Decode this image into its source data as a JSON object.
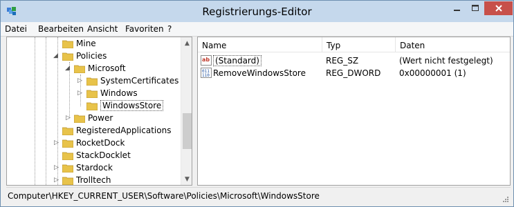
{
  "window": {
    "title": "Registrierungs-Editor",
    "app_icon": "regedit-icon",
    "controls": {
      "minimize": "minimize-icon",
      "maximize": "maximize-icon",
      "close": "close-icon"
    }
  },
  "menubar": {
    "items": [
      {
        "label": "Datei"
      },
      {
        "label": "Bearbeiten"
      },
      {
        "label": "Ansicht"
      },
      {
        "label": "Favoriten"
      },
      {
        "label": "?"
      }
    ]
  },
  "tree": {
    "items": [
      {
        "label": "Mine"
      },
      {
        "label": "Policies"
      },
      {
        "label": "Microsoft"
      },
      {
        "label": "SystemCertificates"
      },
      {
        "label": "Windows"
      },
      {
        "label": "WindowsStore"
      },
      {
        "label": "Power"
      },
      {
        "label": "RegisteredApplications"
      },
      {
        "label": "RocketDock"
      },
      {
        "label": "StackDocklet"
      },
      {
        "label": "Stardock"
      },
      {
        "label": "Trolltech"
      }
    ]
  },
  "list": {
    "columns": {
      "name": "Name",
      "type": "Typ",
      "data": "Daten"
    },
    "rows": [
      {
        "name": "(Standard)",
        "type": "REG_SZ",
        "data": "(Wert nicht festgelegt)",
        "icon": "string-value-icon"
      },
      {
        "name": "RemoveWindowsStore",
        "type": "REG_DWORD",
        "data": "0x00000001 (1)",
        "icon": "binary-value-icon"
      }
    ]
  },
  "status": {
    "path": "Computer\\HKEY_CURRENT_USER\\Software\\Policies\\Microsoft\\WindowsStore"
  },
  "colors": {
    "titlebar": "#c5d8ec",
    "close_button": "#c7504a",
    "folder": "#e8c34a"
  }
}
